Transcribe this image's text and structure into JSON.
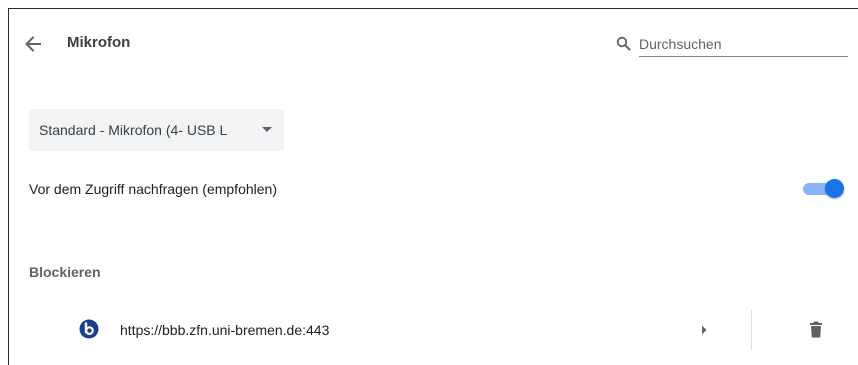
{
  "header": {
    "title": "Mikrofon",
    "search_placeholder": "Durchsuchen",
    "search_value": ""
  },
  "device_select": {
    "selected": "Standard - Mikrofon (4- USB L"
  },
  "ask_toggle": {
    "label": "Vor dem Zugriff nachfragen (empfohlen)",
    "enabled": true
  },
  "block_section": {
    "heading": "Blockieren",
    "sites": [
      {
        "url": "https://bbb.zfn.uni-bremen.de:443",
        "favicon": "bigbluebutton-icon"
      }
    ]
  },
  "colors": {
    "accent": "#1a73e8",
    "accent_track": "#8ab4f8",
    "favicon_bg": "#1a3f8f"
  },
  "icons": {
    "back": "arrow-back-icon",
    "search": "search-icon",
    "dropdown": "caret-down-icon",
    "expand": "chevron-right-icon",
    "delete": "trash-icon"
  }
}
